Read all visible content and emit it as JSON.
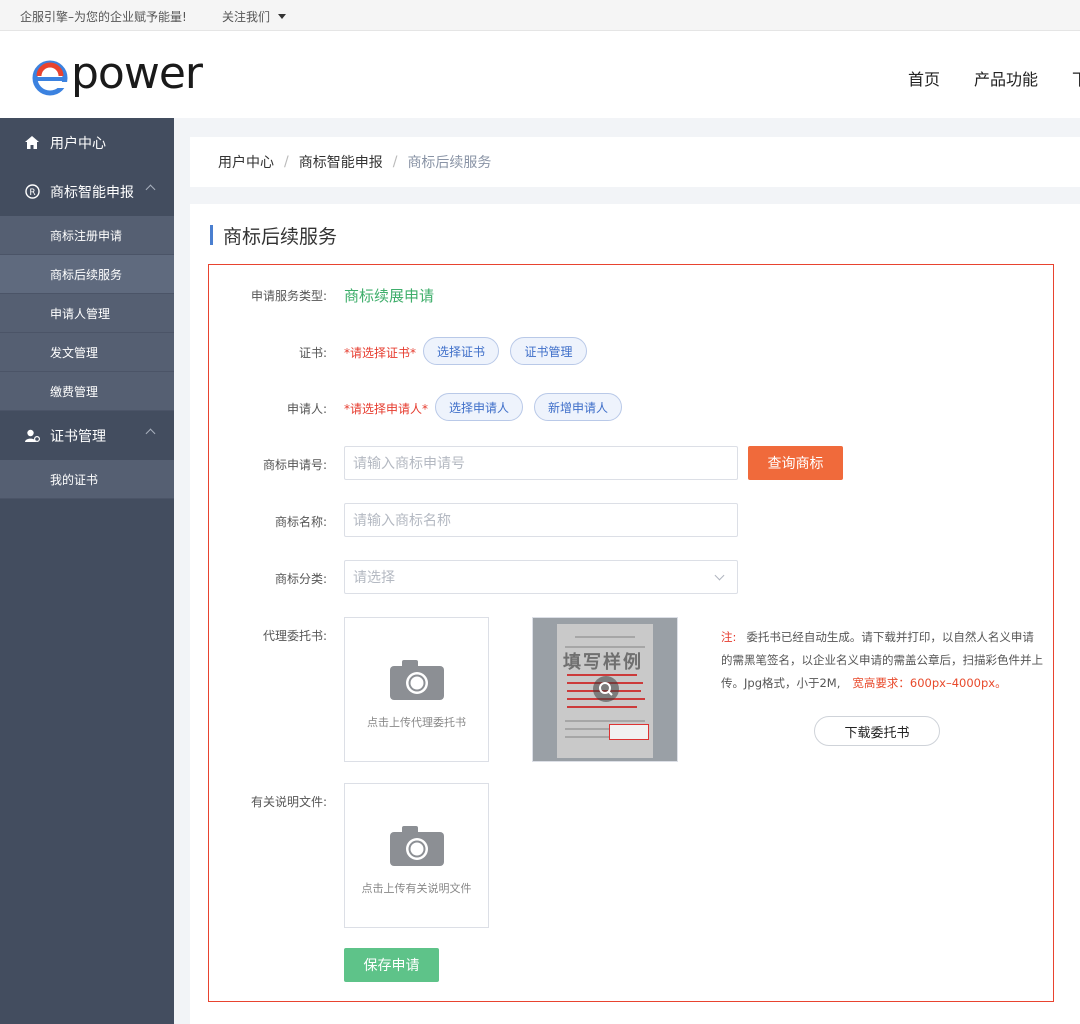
{
  "topbar": {
    "slogan": "企服引擎–为您的企业赋予能量!",
    "follow": "关注我们"
  },
  "header": {
    "logo_text": "power",
    "nav": [
      "首页",
      "产品功能",
      "下"
    ]
  },
  "sidebar": {
    "groups": [
      {
        "label": "用户中心",
        "icon": "home-icon"
      },
      {
        "label": "商标智能申报",
        "icon": "registered-icon",
        "items": [
          "商标注册申请",
          "商标后续服务",
          "申请人管理",
          "发文管理",
          "缴费管理"
        ]
      },
      {
        "label": "证书管理",
        "icon": "user-cert-icon",
        "items": [
          "我的证书"
        ]
      }
    ],
    "active_item": "商标后续服务"
  },
  "breadcrumb": [
    "用户中心",
    "商标智能申报",
    "商标后续服务"
  ],
  "page_title": "商标后续服务",
  "form": {
    "service_type": {
      "label": "申请服务类型:",
      "value": "商标续展申请"
    },
    "certificate": {
      "label": "证书:",
      "required": "*请选择证书*",
      "btn_select": "选择证书",
      "btn_manage": "证书管理"
    },
    "applicant": {
      "label": "申请人:",
      "required": "*请选择申请人*",
      "btn_select": "选择申请人",
      "btn_add": "新增申请人"
    },
    "app_number": {
      "label": "商标申请号:",
      "placeholder": "请输入商标申请号",
      "btn_query": "查询商标"
    },
    "tm_name": {
      "label": "商标名称:",
      "placeholder": "请输入商标名称"
    },
    "tm_class": {
      "label": "商标分类:",
      "placeholder": "请选择"
    },
    "poa": {
      "label": "代理委托书:",
      "upload_text": "点击上传代理委托书",
      "sample_watermark": "填写样例",
      "note_label": "注:",
      "note_text": "委托书已经自动生成。请下载并打印，以自然人名义申请的需黑笔签名，以企业名义申请的需盖公章后，扫描彩色件并上传。Jpg格式，小于2M,",
      "note_highlight": "宽高要求：600px–4000px。",
      "btn_download": "下载委托书"
    },
    "docs": {
      "label": "有关说明文件:",
      "upload_text": "点击上传有关说明文件"
    },
    "btn_save": "保存申请"
  },
  "colors": {
    "accent_blue": "#4a7fd0",
    "green": "#3fae6b",
    "orange": "#f06a3b",
    "red": "#e63b2e",
    "sidebar": "#434d5f"
  }
}
